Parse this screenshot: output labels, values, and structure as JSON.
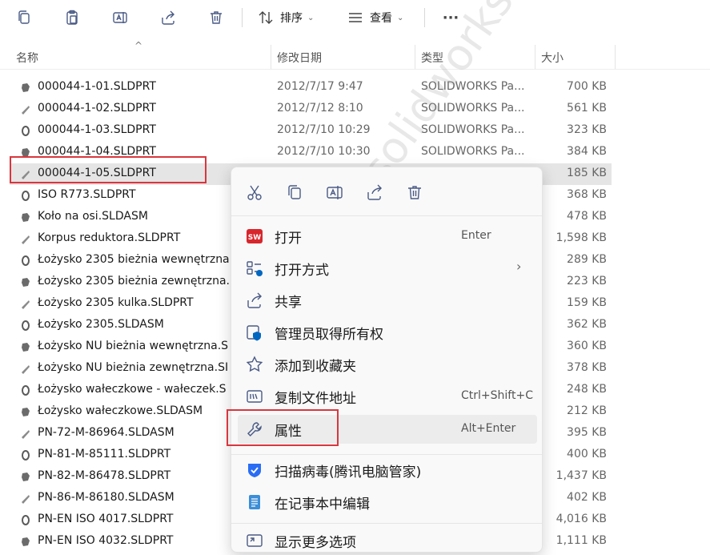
{
  "toolbar": {
    "buttons": [
      {
        "icon": "copy-icon"
      },
      {
        "icon": "paste-icon"
      },
      {
        "icon": "rename-icon"
      },
      {
        "icon": "share-icon"
      },
      {
        "icon": "delete-icon"
      }
    ],
    "sort_label": "排序",
    "view_label": "查看",
    "more_label": "···"
  },
  "columns": {
    "name": "名称",
    "date": "修改日期",
    "type": "类型",
    "size": "大小"
  },
  "files": [
    {
      "name": "000044-1-01.SLDPRT",
      "date": "2012/7/17 9:47",
      "type": "SOLIDWORKS Pa...",
      "size": "700 KB",
      "selected": false
    },
    {
      "name": "000044-1-02.SLDPRT",
      "date": "2012/7/12 8:10",
      "type": "SOLIDWORKS Pa...",
      "size": "561 KB",
      "selected": false
    },
    {
      "name": "000044-1-03.SLDPRT",
      "date": "2012/7/10 10:29",
      "type": "SOLIDWORKS Pa...",
      "size": "323 KB",
      "selected": false
    },
    {
      "name": "000044-1-04.SLDPRT",
      "date": "2012/7/10 10:30",
      "type": "SOLIDWORKS Pa...",
      "size": "384 KB",
      "selected": false
    },
    {
      "name": "000044-1-05.SLDPRT",
      "date": "",
      "type": "",
      "size": "185 KB",
      "selected": true
    },
    {
      "name": "ISO R773.SLDPRT",
      "date": "",
      "type": "",
      "size": "368 KB",
      "selected": false
    },
    {
      "name": "Koło na osi.SLDASM",
      "date": "",
      "type": "",
      "size": "478 KB",
      "selected": false
    },
    {
      "name": "Korpus reduktora.SLDPRT",
      "date": "",
      "type": "",
      "size": "1,598 KB",
      "selected": false
    },
    {
      "name": "Łożysko 2305 bieżnia wewnętrzna",
      "date": "",
      "type": "",
      "size": "289 KB",
      "selected": false
    },
    {
      "name": "Łożysko 2305 bieżnia zewnętrzna.",
      "date": "",
      "type": "",
      "size": "223 KB",
      "selected": false
    },
    {
      "name": "Łożysko 2305 kulka.SLDPRT",
      "date": "",
      "type": "",
      "size": "159 KB",
      "selected": false
    },
    {
      "name": "Łożysko 2305.SLDASM",
      "date": "",
      "type": "",
      "size": "362 KB",
      "selected": false
    },
    {
      "name": "Łożysko NU bieżnia wewnętrzna.S",
      "date": "",
      "type": "",
      "size": "360 KB",
      "selected": false
    },
    {
      "name": "Łożysko NU bieżnia zewnętrzna.SI",
      "date": "",
      "type": "",
      "size": "378 KB",
      "selected": false
    },
    {
      "name": "Łożysko wałeczkowe - wałeczek.S",
      "date": "",
      "type": "",
      "size": "248 KB",
      "selected": false
    },
    {
      "name": "Łożysko wałeczkowe.SLDASM",
      "date": "",
      "type": "",
      "size": "212 KB",
      "selected": false
    },
    {
      "name": "PN-72-M-86964.SLDASM",
      "date": "",
      "type": "",
      "size": "395 KB",
      "selected": false
    },
    {
      "name": "PN-81-M-85111.SLDPRT",
      "date": "",
      "type": "",
      "size": "400 KB",
      "selected": false
    },
    {
      "name": "PN-82-M-86478.SLDPRT",
      "date": "",
      "type": "",
      "size": "1,437 KB",
      "selected": false
    },
    {
      "name": "PN-86-M-86180.SLDASM",
      "date": "",
      "type": "",
      "size": "402 KB",
      "selected": false
    },
    {
      "name": "PN-EN ISO 4017.SLDPRT",
      "date": "",
      "type": "",
      "size": "4,016 KB",
      "selected": false
    },
    {
      "name": "PN-EN ISO 4032.SLDPRT",
      "date": "",
      "type": "",
      "size": "1,111 KB",
      "selected": false
    }
  ],
  "context_menu": {
    "top_icons": [
      "cut-icon",
      "copy-icon",
      "rename-icon",
      "share-icon",
      "delete-icon"
    ],
    "items": [
      {
        "label": "打开",
        "shortcut": "Enter",
        "icon": "solidworks-icon"
      },
      {
        "label": "打开方式",
        "shortcut": "",
        "icon": "open-with-icon",
        "submenu": true
      },
      {
        "label": "共享",
        "shortcut": "",
        "icon": "share-icon"
      },
      {
        "label": "管理员取得所有权",
        "shortcut": "",
        "icon": "admin-shield-icon"
      },
      {
        "label": "添加到收藏夹",
        "shortcut": "",
        "icon": "star-icon"
      },
      {
        "label": "复制文件地址",
        "shortcut": "Ctrl+Shift+C",
        "icon": "copy-path-icon"
      },
      {
        "label": "属性",
        "shortcut": "Alt+Enter",
        "icon": "wrench-icon",
        "highlighted": true
      },
      {
        "label": "扫描病毒(腾讯电脑管家)",
        "shortcut": "",
        "icon": "tencent-shield-icon"
      },
      {
        "label": "在记事本中编辑",
        "shortcut": "",
        "icon": "notepad-icon"
      },
      {
        "label": "显示更多选项",
        "shortcut": "",
        "icon": "more-options-icon"
      }
    ]
  },
  "watermark": "南京cz solidworks.com",
  "colors": {
    "highlight_box": "#d9363e",
    "selected_row": "#e5e5e5",
    "accent": "#0067c0"
  }
}
